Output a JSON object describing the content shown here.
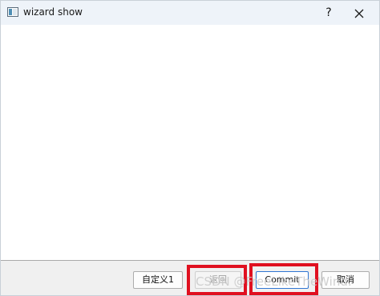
{
  "window": {
    "title": "wizard show",
    "help_label": "?"
  },
  "buttons": {
    "custom1_label": "自定义1",
    "back_label": "返回",
    "commit_label": "Commit",
    "cancel_label": "取消"
  },
  "watermark": {
    "text": "CSDN @FreeLikeTheWind."
  },
  "colors": {
    "titlebar_bg": "#eef3f9",
    "highlight": "#e01020",
    "commit_border": "#2f76d2",
    "bottom_bg": "#f0f0f0"
  },
  "icons": {
    "app": "window-app-icon",
    "close": "close-icon"
  }
}
